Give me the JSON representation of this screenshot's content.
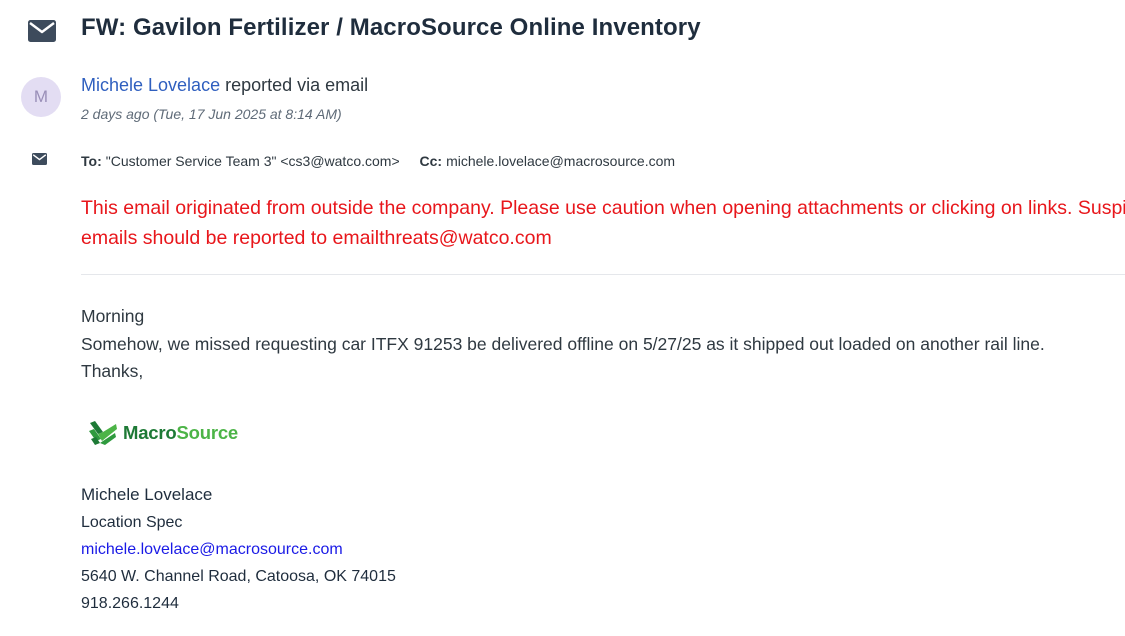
{
  "email": {
    "subject": "FW: Gavilon Fertilizer / MacroSource Online Inventory",
    "author": {
      "initial": "M",
      "name": "Michele Lovelace",
      "via": "reported via email"
    },
    "timestamp": "2 days ago (Tue, 17 Jun 2025 at 8:14 AM)",
    "to_label": "To:",
    "to_value": "\"Customer Service Team 3\" <cs3@watco.com>",
    "cc_label": "Cc:",
    "cc_value": "michele.lovelace@macrosource.com",
    "warning": "This email originated from outside the company. Please use caution when opening attachments or clicking on links. Suspicious emails should be reported to emailthreats@watco.com",
    "body": [
      "Morning",
      "Somehow, we missed requesting car ITFX 91253 be delivered offline on 5/27/25 as it shipped out loaded on another rail line.",
      "Thanks,"
    ],
    "logo": {
      "part1": "Macro",
      "part2": "Source"
    },
    "signature": {
      "name": "Michele Lovelace",
      "title": "Location Spec",
      "email": "michele.lovelace@macrosource.com",
      "address": "5640 W. Channel Road, Catoosa, OK 74015",
      "phone": "918.266.1244"
    }
  },
  "colors": {
    "author_link": "#2f5fbf",
    "warning": "#e8161b",
    "sig_email": "#1a1ae6",
    "logo_dark_green": "#1e7a36",
    "logo_light_green": "#4cb447"
  },
  "icons": [
    "envelope-icon",
    "macrosource-logo-mark"
  ]
}
